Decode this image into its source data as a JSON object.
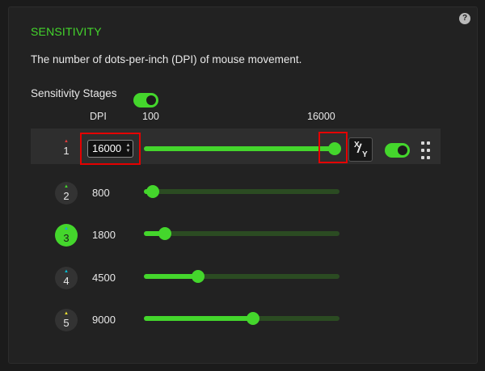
{
  "help_icon": "question-icon",
  "help_label": "?",
  "section": {
    "title": "SENSITIVITY",
    "description": "The number of dots-per-inch (DPI) of mouse movement."
  },
  "stages_toggle": {
    "label": "Sensitivity Stages",
    "on": true
  },
  "header": {
    "dpi": "DPI",
    "min": "100",
    "max": "16000"
  },
  "slider_range": {
    "min": 100,
    "max": 16000
  },
  "xy_button": {
    "x": "X",
    "y": "Y"
  },
  "stages": [
    {
      "number": "1",
      "dpi": "16000",
      "value": 16000,
      "active": true,
      "indicator_color": "#e03a3a"
    },
    {
      "number": "2",
      "dpi": "800",
      "value": 800,
      "active": false,
      "indicator_color": "#44d62c"
    },
    {
      "number": "3",
      "dpi": "1800",
      "value": 1800,
      "active": false,
      "indicator_color": "#1ba1e2",
      "selected": true
    },
    {
      "number": "4",
      "dpi": "4500",
      "value": 4500,
      "active": false,
      "indicator_color": "#00bcd4"
    },
    {
      "number": "5",
      "dpi": "9000",
      "value": 9000,
      "active": false,
      "indicator_color": "#f0e130"
    }
  ],
  "colors": {
    "accent": "#44d62c",
    "highlight": "#e50000",
    "panel": "#222222"
  }
}
